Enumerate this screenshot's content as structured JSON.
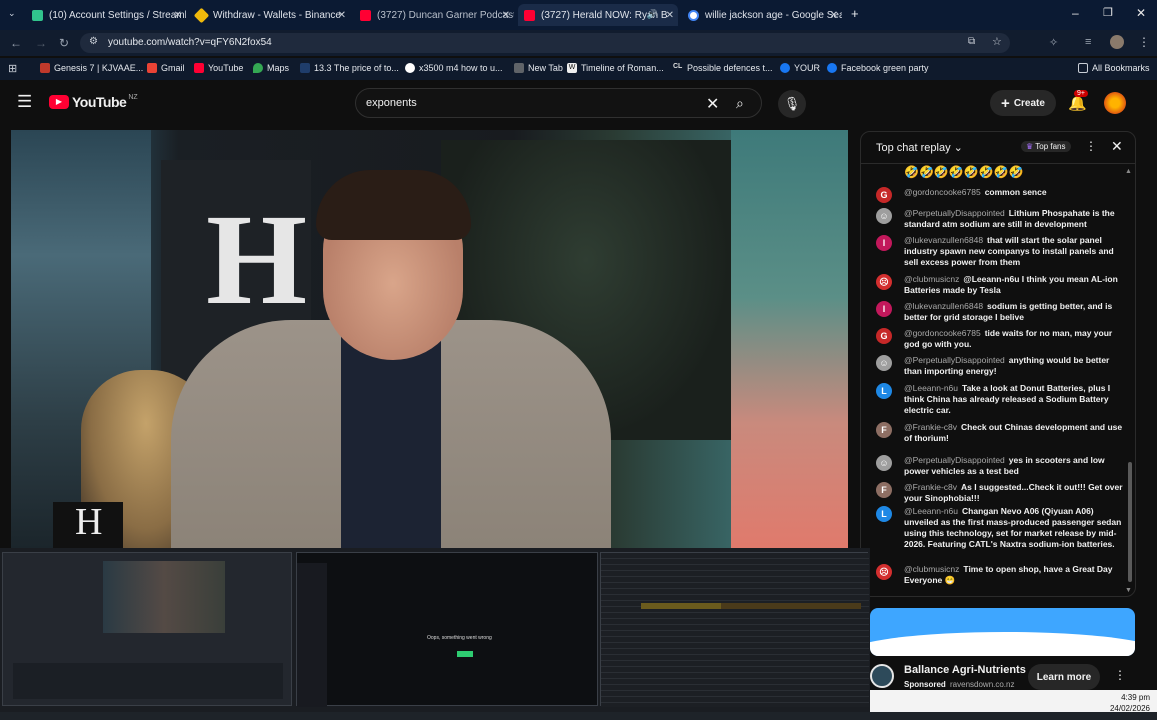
{
  "browser": {
    "tabs": [
      {
        "title": "(10) Account Settings / Streaml",
        "icon": "streamlabs-icon",
        "color": "#31c48d",
        "active": false
      },
      {
        "title": "Withdraw - Wallets - Binance",
        "icon": "binance-icon",
        "color": "#f0b90b",
        "active": false
      },
      {
        "title": "(3727) Duncan Garner Podcast",
        "icon": "youtube-icon",
        "color": "#ff0033",
        "active": false
      },
      {
        "title": "(3727) Herald NOW: Ryan B",
        "icon": "youtube-icon",
        "color": "#ff0033",
        "active": true
      },
      {
        "title": "willie jackson age - Google Sea",
        "icon": "google-icon",
        "color": "#4285f4",
        "active": false
      }
    ],
    "new_tab_symbol": "+",
    "window_controls": {
      "minimize": "–",
      "maximize": "❐",
      "close": "✕"
    },
    "url": "youtube.com/watch?v=qFY6N2fox54",
    "bookmarks": [
      {
        "label": "Genesis 7 | KJVAAE...",
        "color": "#c0392b"
      },
      {
        "label": "Gmail",
        "color": "#ea4335"
      },
      {
        "label": "YouTube",
        "color": "#ff0033"
      },
      {
        "label": "Maps",
        "color": "#34a853"
      },
      {
        "label": "13.3 The price of to...",
        "color": "#1f3d6b"
      },
      {
        "label": "x3500 m4 how to u...",
        "color": "#4285f4"
      },
      {
        "label": "New Tab",
        "color": "#5f6368"
      },
      {
        "label": "Timeline of Roman...",
        "color": "#eeeeee"
      },
      {
        "label": "Possible defences t...",
        "color": "#dddddd"
      },
      {
        "label": "YOUR",
        "color": "#1877f2"
      },
      {
        "label": "Facebook green party",
        "color": "#1877f2"
      }
    ],
    "all_bookmarks_label": "All Bookmarks"
  },
  "youtube": {
    "logo_text": "YouTube",
    "region": "NZ",
    "search_query": "exponents",
    "create_label": "Create",
    "notifications_badge": "9+"
  },
  "video": {
    "watermark": "H"
  },
  "chat": {
    "title": "Top chat replay",
    "top_fans_label": "Top fans",
    "emoji_row": "🤣🤣🤣🤣🤣🤣🤣🤣",
    "messages": [
      {
        "author": "@gordoncooke6785",
        "text": "common sence",
        "avatar_letter": "G",
        "avatar_color": "#c62828"
      },
      {
        "author": "@PerpetuallyDisappointed",
        "text": "Lithium Phospahate is the standard atm sodium are still in development",
        "avatar_letter": "☺",
        "avatar_color": "#9e9e9e"
      },
      {
        "author": "@lukevanzullen6848",
        "text": "that will start the solar panel industry spawn new companys to install panels and sell excess power from them",
        "avatar_letter": "l",
        "avatar_color": "#c2185b"
      },
      {
        "author": "@clubmusicnz",
        "text": "@Leeann-n6u I think you mean AL-ion Batteries made by Tesla",
        "avatar_letter": "☹",
        "avatar_color": "#d32f2f"
      },
      {
        "author": "@lukevanzullen6848",
        "text": "sodium is getting better, and is better for grid storage I belive",
        "avatar_letter": "l",
        "avatar_color": "#c2185b"
      },
      {
        "author": "@gordoncooke6785",
        "text": "tide waits for no man, may your god go with you.",
        "avatar_letter": "G",
        "avatar_color": "#c62828"
      },
      {
        "author": "@PerpetuallyDisappointed",
        "text": "anything would be better than importing energy!",
        "avatar_letter": "☺",
        "avatar_color": "#9e9e9e"
      },
      {
        "author": "@Leeann-n6u",
        "text": "Take a look at Donut Batteries, plus I think China has already released a Sodium Battery electric car.",
        "avatar_letter": "L",
        "avatar_color": "#1e88e5"
      },
      {
        "author": "@Frankie-c8v",
        "text": "Check out Chinas development and use of thorium!",
        "avatar_letter": "F",
        "avatar_color": "#8d6e63"
      },
      {
        "author": "@PerpetuallyDisappointed",
        "text": "yes in scooters and low power vehicles as a test bed",
        "avatar_letter": "☺",
        "avatar_color": "#9e9e9e"
      },
      {
        "author": "@Frankie-c8v",
        "text": "As I suggested...Check it out!!! Get over your Sinophobia!!!",
        "avatar_letter": "F",
        "avatar_color": "#8d6e63"
      },
      {
        "author": "@Leeann-n6u",
        "text": "Changan Nevo A06 (Qiyuan A06) unveiled as the first mass-produced passenger sedan using this technology, set for market release by mid-2026. Featuring CATL's Naxtra sodium-ion batteries.",
        "avatar_letter": "L",
        "avatar_color": "#1e88e5"
      },
      {
        "author": "@clubmusicnz",
        "text": "Time to open shop, have a Great Day Everyone 😁",
        "avatar_letter": "☹",
        "avatar_color": "#d32f2f"
      }
    ]
  },
  "ad": {
    "advertiser": "Ballance Agri-Nutrients",
    "sponsored": "Sponsored",
    "domain": "ravensdown.co.nz",
    "cta": "Learn more"
  },
  "thumbnails": {
    "error_text": "Oops, something went wrong"
  },
  "system": {
    "time": "4:39 pm",
    "date": "24/02/2026"
  }
}
